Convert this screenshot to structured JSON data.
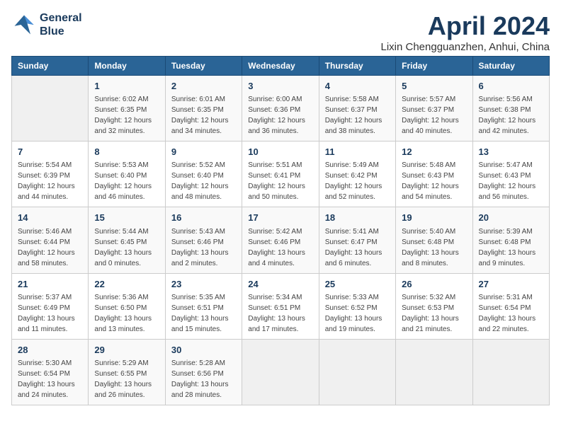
{
  "logo": {
    "line1": "General",
    "line2": "Blue"
  },
  "title": "April 2024",
  "subtitle": "Lixin Chengguanzhen, Anhui, China",
  "days_of_week": [
    "Sunday",
    "Monday",
    "Tuesday",
    "Wednesday",
    "Thursday",
    "Friday",
    "Saturday"
  ],
  "weeks": [
    [
      {
        "day": "",
        "sunrise": "",
        "sunset": "",
        "daylight": ""
      },
      {
        "day": "1",
        "sunrise": "Sunrise: 6:02 AM",
        "sunset": "Sunset: 6:35 PM",
        "daylight": "Daylight: 12 hours and 32 minutes."
      },
      {
        "day": "2",
        "sunrise": "Sunrise: 6:01 AM",
        "sunset": "Sunset: 6:35 PM",
        "daylight": "Daylight: 12 hours and 34 minutes."
      },
      {
        "day": "3",
        "sunrise": "Sunrise: 6:00 AM",
        "sunset": "Sunset: 6:36 PM",
        "daylight": "Daylight: 12 hours and 36 minutes."
      },
      {
        "day": "4",
        "sunrise": "Sunrise: 5:58 AM",
        "sunset": "Sunset: 6:37 PM",
        "daylight": "Daylight: 12 hours and 38 minutes."
      },
      {
        "day": "5",
        "sunrise": "Sunrise: 5:57 AM",
        "sunset": "Sunset: 6:37 PM",
        "daylight": "Daylight: 12 hours and 40 minutes."
      },
      {
        "day": "6",
        "sunrise": "Sunrise: 5:56 AM",
        "sunset": "Sunset: 6:38 PM",
        "daylight": "Daylight: 12 hours and 42 minutes."
      }
    ],
    [
      {
        "day": "7",
        "sunrise": "Sunrise: 5:54 AM",
        "sunset": "Sunset: 6:39 PM",
        "daylight": "Daylight: 12 hours and 44 minutes."
      },
      {
        "day": "8",
        "sunrise": "Sunrise: 5:53 AM",
        "sunset": "Sunset: 6:40 PM",
        "daylight": "Daylight: 12 hours and 46 minutes."
      },
      {
        "day": "9",
        "sunrise": "Sunrise: 5:52 AM",
        "sunset": "Sunset: 6:40 PM",
        "daylight": "Daylight: 12 hours and 48 minutes."
      },
      {
        "day": "10",
        "sunrise": "Sunrise: 5:51 AM",
        "sunset": "Sunset: 6:41 PM",
        "daylight": "Daylight: 12 hours and 50 minutes."
      },
      {
        "day": "11",
        "sunrise": "Sunrise: 5:49 AM",
        "sunset": "Sunset: 6:42 PM",
        "daylight": "Daylight: 12 hours and 52 minutes."
      },
      {
        "day": "12",
        "sunrise": "Sunrise: 5:48 AM",
        "sunset": "Sunset: 6:43 PM",
        "daylight": "Daylight: 12 hours and 54 minutes."
      },
      {
        "day": "13",
        "sunrise": "Sunrise: 5:47 AM",
        "sunset": "Sunset: 6:43 PM",
        "daylight": "Daylight: 12 hours and 56 minutes."
      }
    ],
    [
      {
        "day": "14",
        "sunrise": "Sunrise: 5:46 AM",
        "sunset": "Sunset: 6:44 PM",
        "daylight": "Daylight: 12 hours and 58 minutes."
      },
      {
        "day": "15",
        "sunrise": "Sunrise: 5:44 AM",
        "sunset": "Sunset: 6:45 PM",
        "daylight": "Daylight: 13 hours and 0 minutes."
      },
      {
        "day": "16",
        "sunrise": "Sunrise: 5:43 AM",
        "sunset": "Sunset: 6:46 PM",
        "daylight": "Daylight: 13 hours and 2 minutes."
      },
      {
        "day": "17",
        "sunrise": "Sunrise: 5:42 AM",
        "sunset": "Sunset: 6:46 PM",
        "daylight": "Daylight: 13 hours and 4 minutes."
      },
      {
        "day": "18",
        "sunrise": "Sunrise: 5:41 AM",
        "sunset": "Sunset: 6:47 PM",
        "daylight": "Daylight: 13 hours and 6 minutes."
      },
      {
        "day": "19",
        "sunrise": "Sunrise: 5:40 AM",
        "sunset": "Sunset: 6:48 PM",
        "daylight": "Daylight: 13 hours and 8 minutes."
      },
      {
        "day": "20",
        "sunrise": "Sunrise: 5:39 AM",
        "sunset": "Sunset: 6:48 PM",
        "daylight": "Daylight: 13 hours and 9 minutes."
      }
    ],
    [
      {
        "day": "21",
        "sunrise": "Sunrise: 5:37 AM",
        "sunset": "Sunset: 6:49 PM",
        "daylight": "Daylight: 13 hours and 11 minutes."
      },
      {
        "day": "22",
        "sunrise": "Sunrise: 5:36 AM",
        "sunset": "Sunset: 6:50 PM",
        "daylight": "Daylight: 13 hours and 13 minutes."
      },
      {
        "day": "23",
        "sunrise": "Sunrise: 5:35 AM",
        "sunset": "Sunset: 6:51 PM",
        "daylight": "Daylight: 13 hours and 15 minutes."
      },
      {
        "day": "24",
        "sunrise": "Sunrise: 5:34 AM",
        "sunset": "Sunset: 6:51 PM",
        "daylight": "Daylight: 13 hours and 17 minutes."
      },
      {
        "day": "25",
        "sunrise": "Sunrise: 5:33 AM",
        "sunset": "Sunset: 6:52 PM",
        "daylight": "Daylight: 13 hours and 19 minutes."
      },
      {
        "day": "26",
        "sunrise": "Sunrise: 5:32 AM",
        "sunset": "Sunset: 6:53 PM",
        "daylight": "Daylight: 13 hours and 21 minutes."
      },
      {
        "day": "27",
        "sunrise": "Sunrise: 5:31 AM",
        "sunset": "Sunset: 6:54 PM",
        "daylight": "Daylight: 13 hours and 22 minutes."
      }
    ],
    [
      {
        "day": "28",
        "sunrise": "Sunrise: 5:30 AM",
        "sunset": "Sunset: 6:54 PM",
        "daylight": "Daylight: 13 hours and 24 minutes."
      },
      {
        "day": "29",
        "sunrise": "Sunrise: 5:29 AM",
        "sunset": "Sunset: 6:55 PM",
        "daylight": "Daylight: 13 hours and 26 minutes."
      },
      {
        "day": "30",
        "sunrise": "Sunrise: 5:28 AM",
        "sunset": "Sunset: 6:56 PM",
        "daylight": "Daylight: 13 hours and 28 minutes."
      },
      {
        "day": "",
        "sunrise": "",
        "sunset": "",
        "daylight": ""
      },
      {
        "day": "",
        "sunrise": "",
        "sunset": "",
        "daylight": ""
      },
      {
        "day": "",
        "sunrise": "",
        "sunset": "",
        "daylight": ""
      },
      {
        "day": "",
        "sunrise": "",
        "sunset": "",
        "daylight": ""
      }
    ]
  ]
}
